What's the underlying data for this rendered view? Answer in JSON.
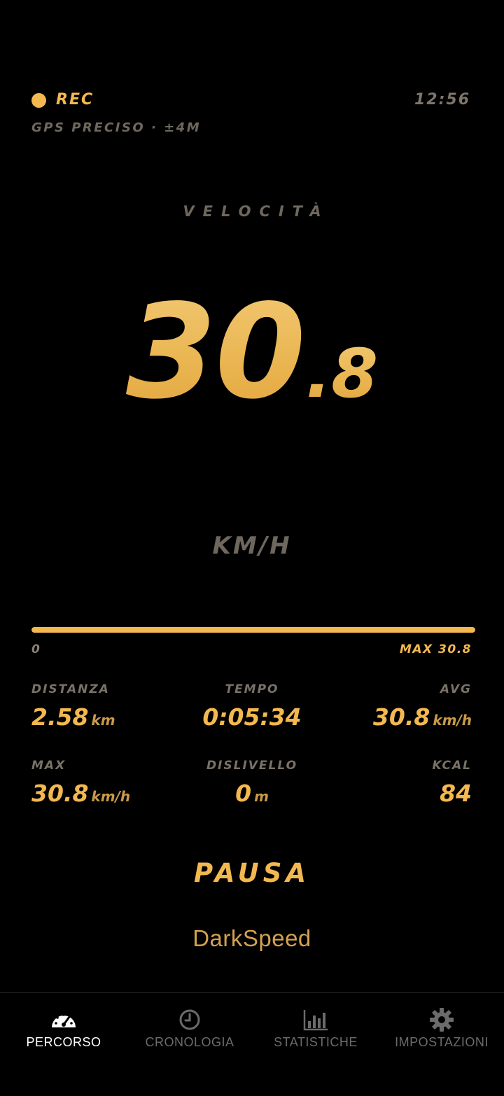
{
  "header": {
    "rec_label": "REC",
    "clock": "12:56",
    "gps_status": "GPS PRECISO · ±4M"
  },
  "speed": {
    "label": "VELOCITÀ",
    "integer": "30",
    "decimal": ".8",
    "unit": "KM/H"
  },
  "progress": {
    "fill_fraction": 1.0,
    "min_label": "0",
    "max_label": "MAX 30.8"
  },
  "stats": {
    "distanza": {
      "label": "DISTANZA",
      "value": "2.58",
      "unit": "km"
    },
    "tempo": {
      "label": "TEMPO",
      "value": "0:05:34"
    },
    "avg": {
      "label": "AVG",
      "value": "30.8",
      "unit": "km/h"
    },
    "max": {
      "label": "MAX",
      "value": "30.8",
      "unit": "km/h"
    },
    "dislivello": {
      "label": "DISLIVELLO",
      "value": "0",
      "unit": "m"
    },
    "kcal": {
      "label": "KCAL",
      "value": "84"
    }
  },
  "pause_button": "PAUSA",
  "brand": "DarkSpeed",
  "nav": {
    "items": [
      {
        "label": "PERCORSO",
        "icon": "speedometer-icon",
        "active": true
      },
      {
        "label": "CRONOLOGIA",
        "icon": "clock-icon",
        "active": false
      },
      {
        "label": "STATISTICHE",
        "icon": "bar-chart-icon",
        "active": false
      },
      {
        "label": "IMPOSTAZIONI",
        "icon": "gear-icon",
        "active": false
      }
    ]
  },
  "colors": {
    "accent": "#f3b84f",
    "background": "#000000",
    "muted": "#6e675d"
  }
}
